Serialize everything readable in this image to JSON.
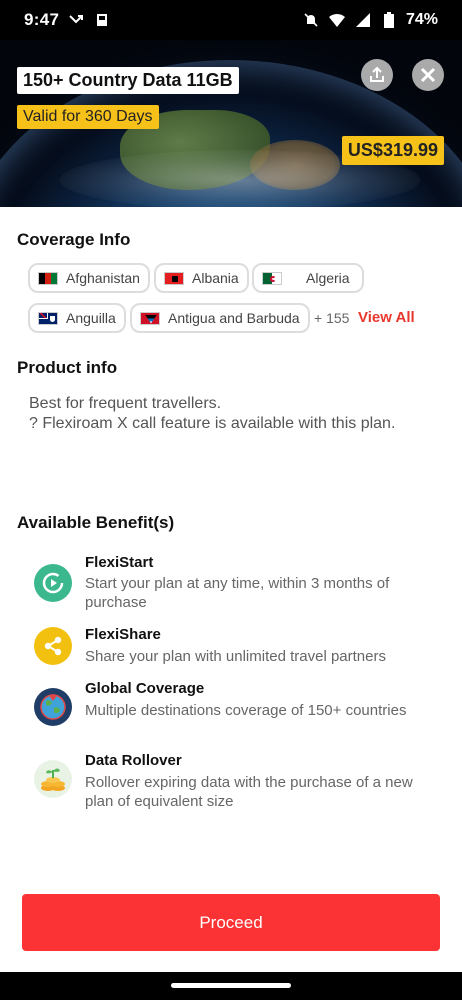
{
  "status_bar": {
    "time": "9:47",
    "battery": "74%"
  },
  "hero": {
    "title": "150+ Country Data 11GB",
    "validity": "Valid for 360 Days",
    "price": "US$319.99"
  },
  "coverage": {
    "heading": "Coverage Info",
    "countries": [
      "Afghanistan",
      "Albania",
      "Algeria",
      "Anguilla",
      "Antigua and Barbuda"
    ],
    "more_count": "+ 155",
    "view_all": "View All"
  },
  "product": {
    "heading": "Product info",
    "line1": "Best for frequent travellers.",
    "line2": "? Flexiroam X call feature is available with this plan."
  },
  "benefits": {
    "heading": "Available Benefit(s)",
    "items": [
      {
        "title": "FlexiStart",
        "desc": "Start your plan at any time, within 3 months of purchase"
      },
      {
        "title": "FlexiShare",
        "desc": "Share your plan with unlimited travel partners"
      },
      {
        "title": "Global Coverage",
        "desc": "Multiple destinations coverage of 150+ countries"
      },
      {
        "title": "Data Rollover",
        "desc": "Rollover expiring data with the purchase of a new plan of equivalent size"
      }
    ]
  },
  "actions": {
    "proceed": "Proceed"
  },
  "colors": {
    "accent": "#fb3334",
    "badge": "#f6c21a",
    "link": "#e8382f"
  }
}
